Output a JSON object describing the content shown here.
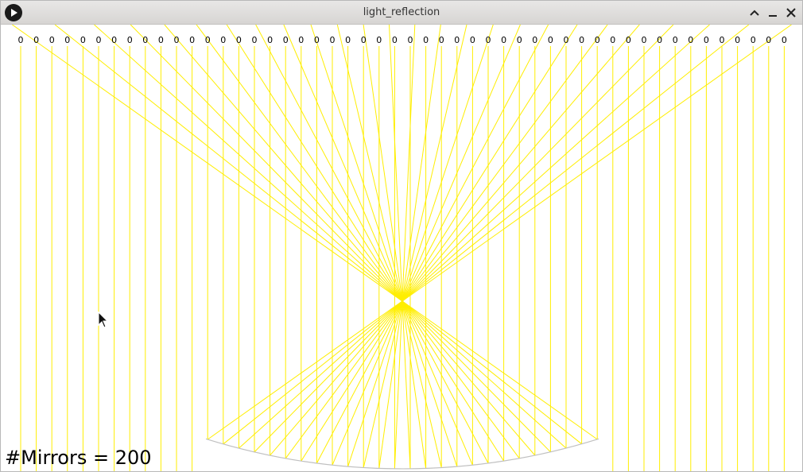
{
  "window": {
    "title": "light_reflection",
    "icon": "play-icon",
    "controls": [
      "chevron-up-icon",
      "minimize-icon",
      "close-icon"
    ]
  },
  "scene": {
    "source_label": "0",
    "mirror_count_text": "#Mirrors = 200",
    "ray_color": "#ffee00",
    "mirror_color": "#c0c0c0",
    "background_color": "#ffffff"
  }
}
